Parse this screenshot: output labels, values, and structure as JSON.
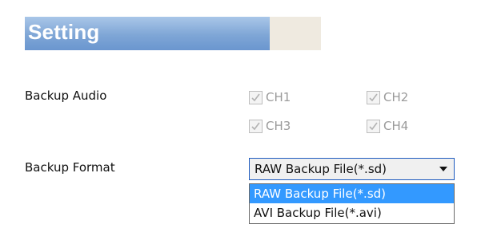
{
  "header": {
    "title": "Setting"
  },
  "backup_audio": {
    "label": "Backup Audio",
    "channels": [
      {
        "label": "CH1",
        "checked": true,
        "disabled": true
      },
      {
        "label": "CH2",
        "checked": true,
        "disabled": true
      },
      {
        "label": "CH3",
        "checked": true,
        "disabled": true
      },
      {
        "label": "CH4",
        "checked": true,
        "disabled": true
      }
    ]
  },
  "backup_format": {
    "label": "Backup Format",
    "selected": "RAW Backup File(*.sd)",
    "options": [
      "RAW Backup File(*.sd)",
      "AVI Backup File(*.avi)"
    ],
    "highlighted_index": 0
  },
  "colors": {
    "header_gradient_top": "#a9c6e8",
    "header_gradient_bottom": "#6a96cf",
    "header_tail": "#efeae0",
    "selection": "#3399ff",
    "select_border": "#1e5bbf",
    "disabled_text": "#9a9a9a"
  }
}
